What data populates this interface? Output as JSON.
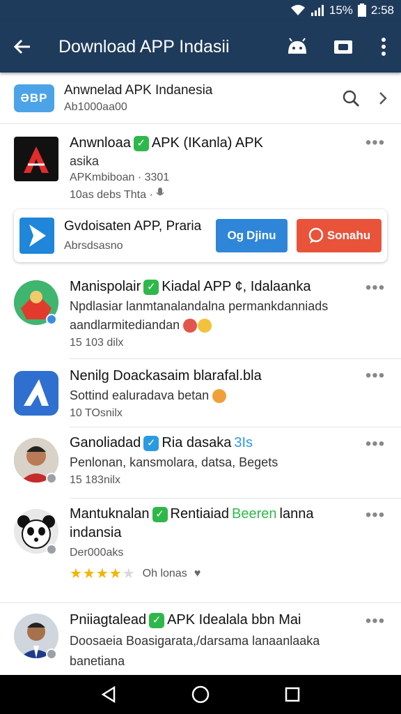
{
  "status_bar": {
    "battery": "15%",
    "time": "2:58"
  },
  "app_bar": {
    "title": "Download APP Indasii",
    "icons": [
      "back-arrow-icon",
      "android-icon",
      "camera-icon",
      "more-vert-icon"
    ]
  },
  "header": {
    "logo_text": "ƏBP",
    "title": "Anwnelad APK Indanesia",
    "subtitle": "Ab1000aa00",
    "icons": [
      "search-icon",
      "chevron-right-icon"
    ]
  },
  "items": [
    {
      "title_a": "Anwnloaa",
      "title_b": "APK (IKanla) APK",
      "line2": "asika",
      "line3": "APKmbiboan · 3301",
      "line4": "10as debs Thta ·",
      "verified": true
    },
    {
      "title_a": "Manispolair",
      "title_b": "Kiadal APP ¢, Idalaanka",
      "line2": "Npdlasiar lanmtanalandalna permankdanniads",
      "line3": "aandlarmitediandan",
      "line4": "15 103 dilx",
      "verified": true
    },
    {
      "title_a": "Nenilg Doackasaim blarafal.bla",
      "line2": "Sottind ealuradava betan",
      "line3": "10 TOsnilx"
    },
    {
      "title_a": "Ganoliadad",
      "title_b": "Ria dasaka",
      "title_c": "3Is",
      "line2": "Penlonan, kansmolara, datsa, Begets",
      "line3": "15 183nilx",
      "verified": true
    },
    {
      "title_a": "Mantuknalan",
      "title_b": "Rentiaiad",
      "title_c": "Beeren",
      "title_d": "lanna",
      "line2": "indansia",
      "line3": "Der000aks",
      "rating": 4,
      "rating_text": "Oh lonas",
      "verified": true
    },
    {
      "title_a": "Pniiagtalead",
      "title_b": "APK Idealala bbn Mai",
      "line2": "Doosaeia Boasigarata,/darsama lanaanlaaka",
      "line3": "banetiana",
      "verified": true
    }
  ],
  "promo": {
    "title": "Gvdoisaten APP, Praria",
    "subtitle": "Abrsdsasno",
    "button_primary": "Djinu",
    "button_primary_prefix": "Og",
    "button_secondary": "Sonahu"
  },
  "nav": {
    "icons": [
      "back-triangle-icon",
      "home-circle-icon",
      "recents-square-icon"
    ]
  },
  "colors": {
    "primary": "#1f3b5c",
    "accent_blue": "#2f86d8",
    "accent_red": "#e8533a",
    "verified_green": "#2eb84b"
  }
}
